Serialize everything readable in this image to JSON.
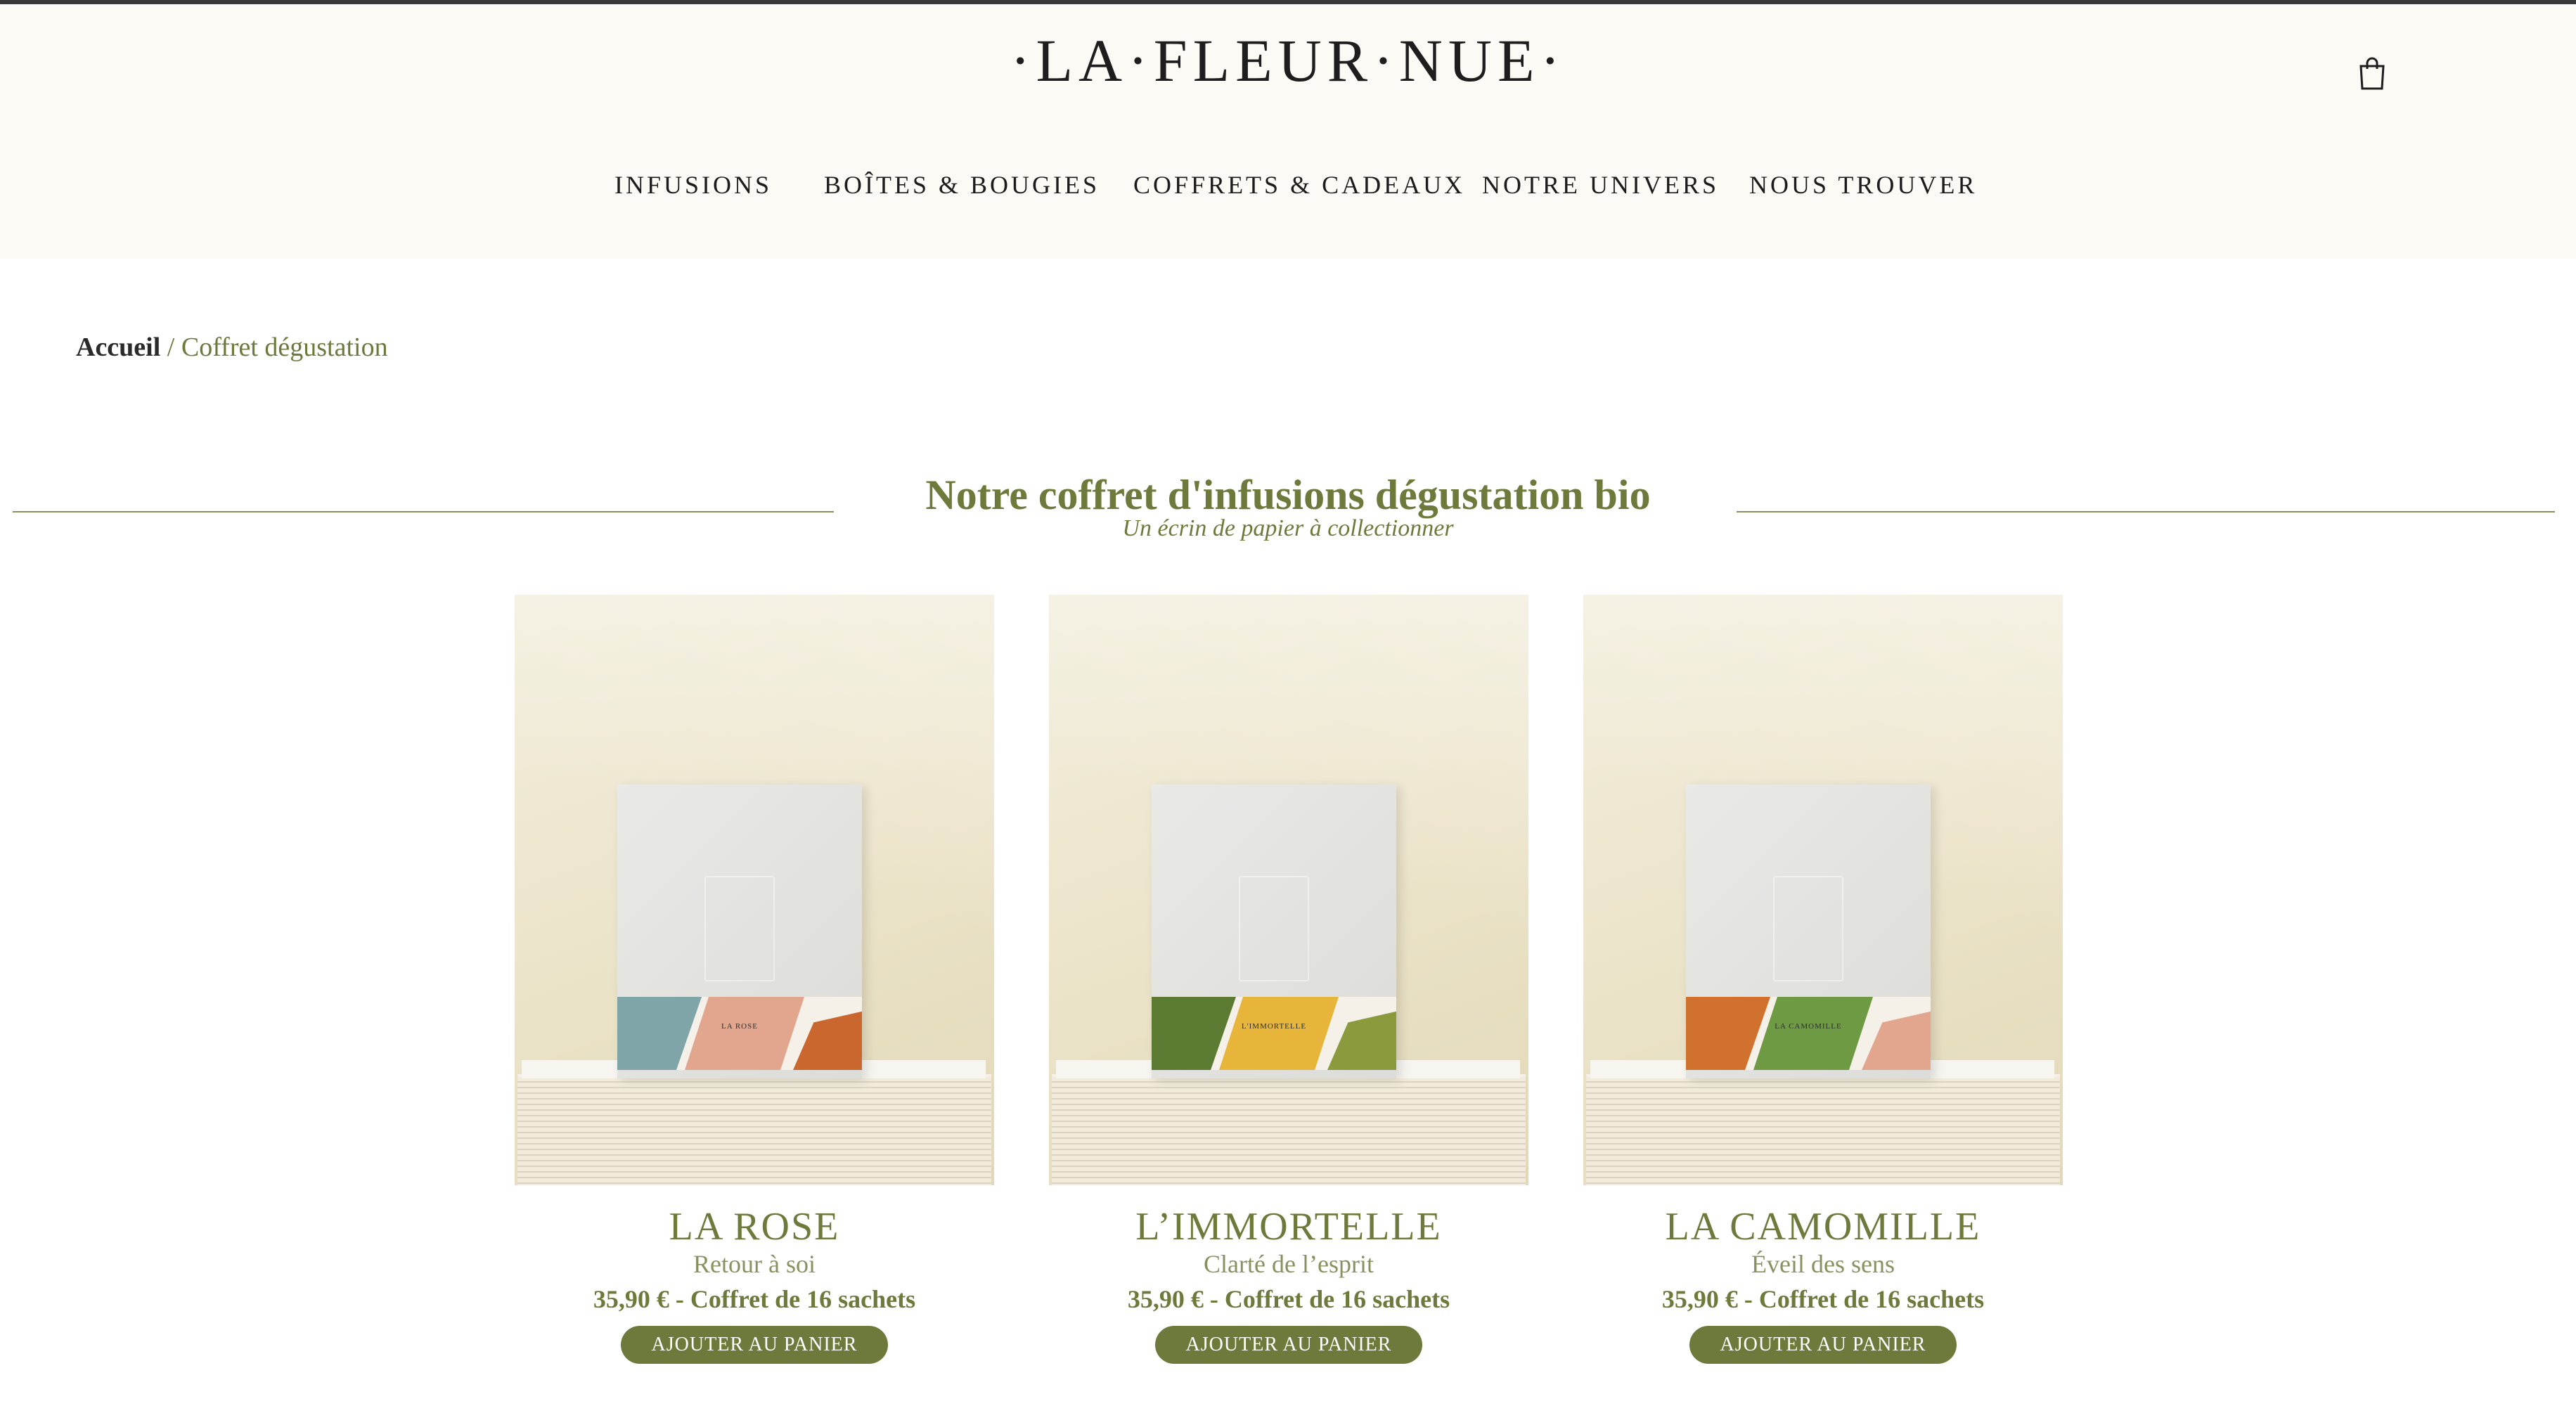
{
  "brand": {
    "logo_text": "·LA·FLEUR·NUE·"
  },
  "header": {
    "nav": [
      {
        "label": "INFUSIONS"
      },
      {
        "label": "BOÎTES & BOUGIES"
      },
      {
        "label": "COFFRETS & CADEAUX"
      },
      {
        "label": "NOTRE UNIVERS"
      },
      {
        "label": "NOUS TROUVER"
      }
    ],
    "cart_icon": "shopping-bag-icon"
  },
  "breadcrumb": {
    "home": "Accueil",
    "separator": " / ",
    "current": "Coffret dégustation"
  },
  "section": {
    "title": "Notre coffret d'infusions dégustation bio",
    "subtitle": "Un écrin de papier à collectionner"
  },
  "products": [
    {
      "name": "LA ROSE",
      "tagline": "Retour à soi",
      "price": "35,90 € - Coffret de 16 sachets",
      "button": "AJOUTER AU PANIER",
      "box_label": "LA ROSE",
      "band_colors": [
        "#7fa5a8",
        "#e2a58e",
        "#c9672f"
      ]
    },
    {
      "name": "L’IMMORTELLE",
      "tagline": "Clarté de l’esprit",
      "price": "35,90 € - Coffret de 16 sachets",
      "button": "AJOUTER AU PANIER",
      "box_label": "L'IMMORTELLE",
      "band_colors": [
        "#5b7a32",
        "#e6b53a",
        "#8a9a3c"
      ]
    },
    {
      "name": "LA CAMOMILLE",
      "tagline": "Éveil des sens",
      "price": "35,90 € - Coffret de 16 sachets",
      "button": "AJOUTER AU PANIER",
      "box_label": "LA CAMOMILLE",
      "band_colors": [
        "#d0722e",
        "#6f9a44",
        "#e2a58e"
      ]
    }
  ],
  "colors": {
    "accent": "#6d7a3b",
    "header_bg": "#fcfaf4"
  }
}
